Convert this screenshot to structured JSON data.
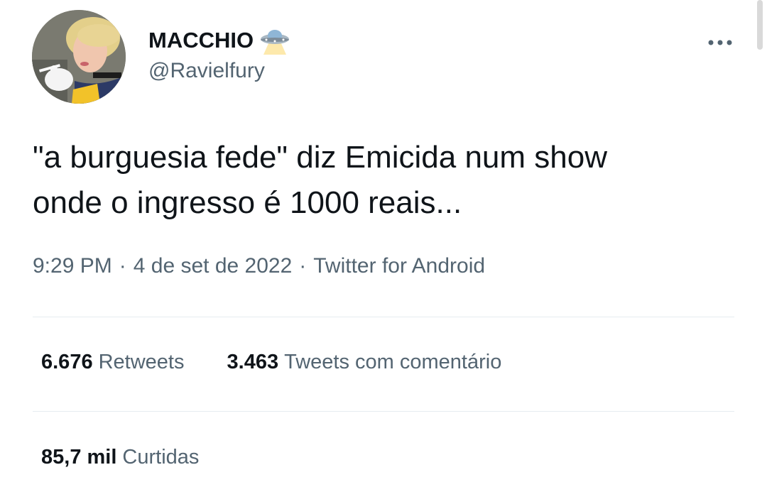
{
  "author": {
    "display_name": "MACCHIO",
    "name_emoji": "ufo-icon",
    "handle": "@Ravielfury"
  },
  "tweet": {
    "text_line1": "\"a burguesia fede\" diz Emicida num show",
    "text_line2": "onde o ingresso é 1000 reais..."
  },
  "meta": {
    "time": "9:29 PM",
    "separator": "·",
    "date": "4 de set de 2022",
    "source": "Twitter for Android"
  },
  "stats": {
    "retweets_count": "6.676",
    "retweets_label": "Retweets",
    "quotes_count": "3.463",
    "quotes_label": "Tweets com comentário",
    "likes_count": "85,7 mil",
    "likes_label": "Curtidas"
  },
  "icons": {
    "more": "more-options-icon"
  },
  "colors": {
    "text_primary": "#0f1419",
    "text_secondary": "#536471",
    "divider": "#e6ecf0"
  }
}
